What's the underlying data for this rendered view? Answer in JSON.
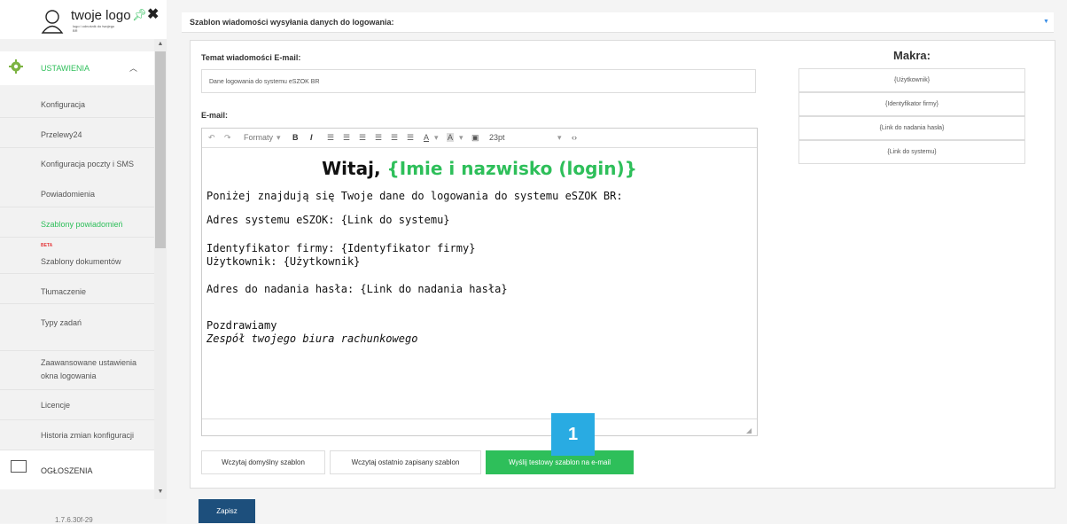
{
  "logo": {
    "title": "twoje logo",
    "subtitle": "logo i odnośnik do twojego BR"
  },
  "sidebar": {
    "section": "USTAWIENIA",
    "items": [
      {
        "label": "Konfiguracja"
      },
      {
        "label": "Przelewy24"
      },
      {
        "label": "Konfiguracja poczty i SMS"
      },
      {
        "label": "Powiadomienia"
      },
      {
        "label": "Szablony powiadomień",
        "active": true
      },
      {
        "label": "Szablony dokumentów",
        "badge": "BETA"
      },
      {
        "label": "Tłumaczenie"
      },
      {
        "label": "Typy zadań"
      },
      {
        "label_lines": [
          "Zaawansowane ustawienia",
          "okna logowania"
        ]
      },
      {
        "label": "Licencje"
      },
      {
        "label": "Historia zmian konfiguracji"
      }
    ],
    "announcements": "OGŁOSZENIA",
    "version": "1.7.6.30f-29"
  },
  "header": {
    "title": "Szablon wiadomości wysyłania danych do logowania:"
  },
  "form": {
    "subject_label": "Temat wiadomości E-mail:",
    "subject_value": "Dane logowania do systemu eSZOK BR",
    "email_label": "E-mail:"
  },
  "toolbar": {
    "formats": "Formaty",
    "fontsize": "23pt"
  },
  "editor": {
    "greeting": "Witaj,",
    "greeting_macro": "{Imie i nazwisko (login)}",
    "lines": [
      "Poniżej znajdują się Twoje dane do logowania do systemu eSZOK BR:",
      "Adres systemu eSZOK: {Link do systemu}",
      "Identyfikator firmy: {Identyfikator firmy}",
      "Użytkownik: {Użytkownik}",
      "Adres do nadania hasła: {Link do nadania hasła}",
      "Pozdrawiamy",
      "Zespół twojego biura rachunkowego"
    ]
  },
  "macros": {
    "title": "Makra:",
    "items": [
      "{Użytkownik}",
      "{Identyfikator firmy}",
      "{Link do nadania hasła}",
      "{Link do systemu}"
    ]
  },
  "buttons": {
    "load_default": "Wczytaj domyślny szablon",
    "load_last": "Wczytaj ostatnio zapisany szablon",
    "send_test": "Wyślij testowy szablon na e-mail",
    "save": "Zapisz"
  },
  "annotation": {
    "number": "1"
  },
  "colors": {
    "accent": "#2ebf5a",
    "badge": "#29abe2",
    "save": "#1d4f7c"
  }
}
